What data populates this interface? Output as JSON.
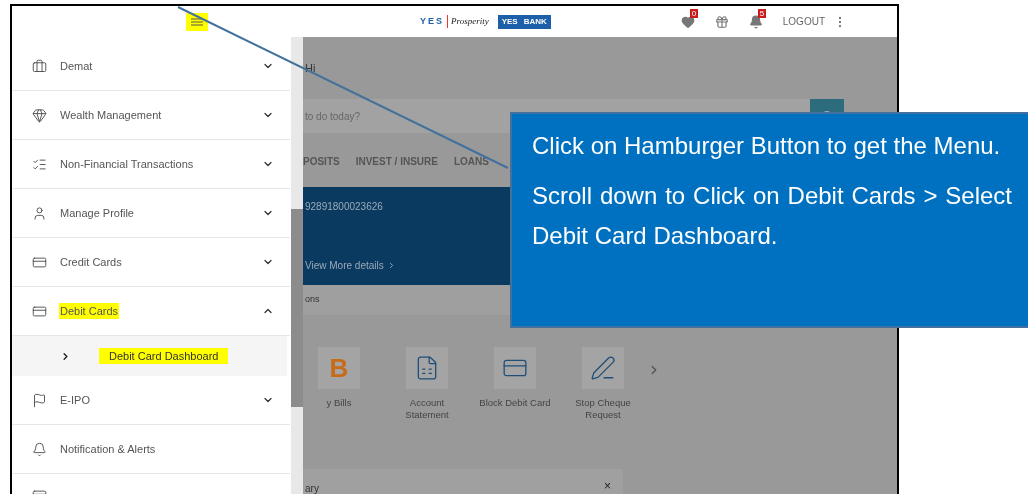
{
  "header": {
    "menu_highlighted": true,
    "logo": {
      "left": "YES",
      "script": "Prosperity",
      "bank_a": "YES",
      "bank_b": "BANK"
    },
    "wishlist_badge": "0",
    "notifications_badge": "5",
    "logout": "LOGOUT"
  },
  "sidebar": {
    "items": [
      {
        "label": "Demat",
        "kind": "group",
        "expanded": false,
        "highlighted": false
      },
      {
        "label": "Wealth Management",
        "kind": "group",
        "expanded": false,
        "highlighted": false
      },
      {
        "label": "Non-Financial Transactions",
        "kind": "group",
        "expanded": false,
        "highlighted": false
      },
      {
        "label": "Manage Profile",
        "kind": "group",
        "expanded": false,
        "highlighted": false
      },
      {
        "label": "Credit Cards",
        "kind": "group",
        "expanded": false,
        "highlighted": false
      },
      {
        "label": "Debit Cards",
        "kind": "group",
        "expanded": true,
        "highlighted": true,
        "children": [
          {
            "label": "Debit Card Dashboard",
            "highlighted": true
          }
        ]
      },
      {
        "label": "E-IPO",
        "kind": "group",
        "expanded": false,
        "highlighted": false
      },
      {
        "label": "Notification & Alerts",
        "kind": "link",
        "highlighted": false
      }
    ]
  },
  "main": {
    "greeting": "Hi",
    "search": {
      "placeholder": "to do today?"
    },
    "tabs": [
      "POSITS",
      "INVEST / INSURE",
      "LOANS"
    ],
    "account": {
      "number": "92891800023626",
      "link": "View More details"
    },
    "section": "ons",
    "quick_links": [
      {
        "label": "y Bills",
        "glyph": "B"
      },
      {
        "label": "Account Statement"
      },
      {
        "label": "Block Debit Card"
      },
      {
        "label": "Stop Cheque Request"
      }
    ],
    "bottom_card": {
      "title": "ary",
      "close": "×"
    }
  },
  "callout": {
    "paragraphs": [
      "Click on Hamburger Button to get the Menu.",
      "Scroll down to Click on Debit Cards > Select Debit Card Dashboard."
    ]
  }
}
